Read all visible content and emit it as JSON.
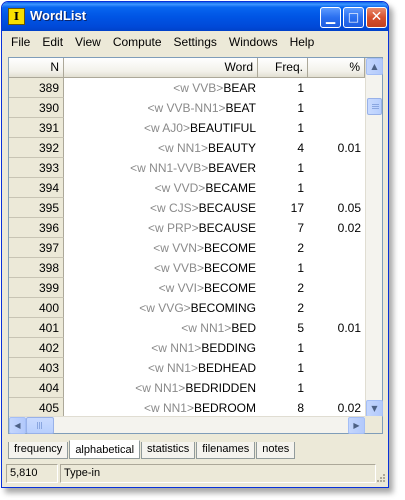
{
  "window": {
    "title": "WordList",
    "app_icon_text": "I"
  },
  "menu": [
    "File",
    "Edit",
    "View",
    "Compute",
    "Settings",
    "Windows",
    "Help"
  ],
  "columns": {
    "n": "N",
    "word": "Word",
    "freq": "Freq.",
    "pct": "%"
  },
  "rows": [
    {
      "n": "389",
      "tag": "<w VVB>",
      "word": "BEAR",
      "freq": "1",
      "pct": ""
    },
    {
      "n": "390",
      "tag": "<w VVB-NN1>",
      "word": "BEAT",
      "freq": "1",
      "pct": ""
    },
    {
      "n": "391",
      "tag": "<w AJ0>",
      "word": "BEAUTIFUL",
      "freq": "1",
      "pct": ""
    },
    {
      "n": "392",
      "tag": "<w NN1>",
      "word": "BEAUTY",
      "freq": "4",
      "pct": "0.01"
    },
    {
      "n": "393",
      "tag": "<w NN1-VVB>",
      "word": "BEAVER",
      "freq": "1",
      "pct": ""
    },
    {
      "n": "394",
      "tag": "<w VVD>",
      "word": "BECAME",
      "freq": "1",
      "pct": ""
    },
    {
      "n": "395",
      "tag": "<w CJS>",
      "word": "BECAUSE",
      "freq": "17",
      "pct": "0.05"
    },
    {
      "n": "396",
      "tag": "<w PRP>",
      "word": "BECAUSE",
      "freq": "7",
      "pct": "0.02"
    },
    {
      "n": "397",
      "tag": "<w VVN>",
      "word": "BECOME",
      "freq": "2",
      "pct": ""
    },
    {
      "n": "398",
      "tag": "<w VVB>",
      "word": "BECOME",
      "freq": "1",
      "pct": ""
    },
    {
      "n": "399",
      "tag": "<w VVI>",
      "word": "BECOME",
      "freq": "2",
      "pct": ""
    },
    {
      "n": "400",
      "tag": "<w VVG>",
      "word": "BECOMING",
      "freq": "2",
      "pct": ""
    },
    {
      "n": "401",
      "tag": "<w NN1>",
      "word": "BED",
      "freq": "5",
      "pct": "0.01"
    },
    {
      "n": "402",
      "tag": "<w NN1>",
      "word": "BEDDING",
      "freq": "1",
      "pct": ""
    },
    {
      "n": "403",
      "tag": "<w NN1>",
      "word": "BEDHEAD",
      "freq": "1",
      "pct": ""
    },
    {
      "n": "404",
      "tag": "<w NN1>",
      "word": "BEDRIDDEN",
      "freq": "1",
      "pct": ""
    },
    {
      "n": "405",
      "tag": "<w NN1>",
      "word": "BEDROOM",
      "freq": "8",
      "pct": "0.02"
    }
  ],
  "tabs": [
    {
      "label": "frequency",
      "active": false
    },
    {
      "label": "alphabetical",
      "active": true
    },
    {
      "label": "statistics",
      "active": false
    },
    {
      "label": "filenames",
      "active": false
    },
    {
      "label": "notes",
      "active": false
    }
  ],
  "status": {
    "count": "5,810",
    "mode": "Type-in"
  },
  "colors": {
    "titlebar": "#0055e5",
    "tag_text": "#8a8a8a",
    "window_bg": "#ece9d8"
  }
}
